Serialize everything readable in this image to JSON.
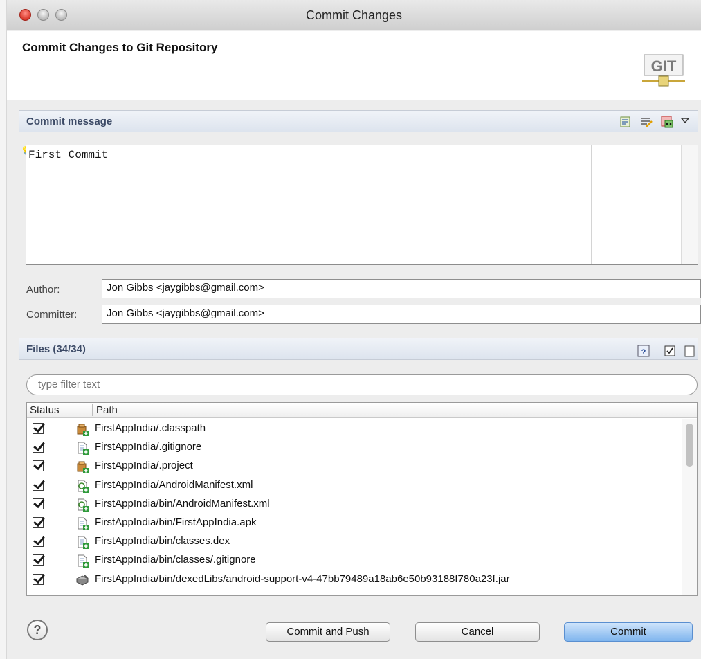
{
  "window": {
    "title": "Commit Changes"
  },
  "header": {
    "title": "Commit Changes to Git Repository",
    "logo_text": "GIT"
  },
  "commit_message": {
    "section_title": "Commit message",
    "text": "First Commit"
  },
  "author": {
    "label": "Author:",
    "value": "Jon Gibbs <jaygibbs@gmail.com>"
  },
  "committer": {
    "label": "Committer:",
    "value": "Jon Gibbs <jaygibbs@gmail.com>"
  },
  "files": {
    "section_title": "Files (34/34)",
    "filter_placeholder": "type filter text",
    "columns": {
      "status": "Status",
      "path": "Path"
    },
    "rows": [
      {
        "icon": "project-file-icon",
        "path": "FirstAppIndia/.classpath"
      },
      {
        "icon": "text-file-add-icon",
        "path": "FirstAppIndia/.gitignore"
      },
      {
        "icon": "project-file-icon",
        "path": "FirstAppIndia/.project"
      },
      {
        "icon": "xml-file-add-icon",
        "path": "FirstAppIndia/AndroidManifest.xml"
      },
      {
        "icon": "xml-file-add-icon",
        "path": "FirstAppIndia/bin/AndroidManifest.xml"
      },
      {
        "icon": "text-file-add-icon",
        "path": "FirstAppIndia/bin/FirstAppIndia.apk"
      },
      {
        "icon": "text-file-add-icon",
        "path": "FirstAppIndia/bin/classes.dex"
      },
      {
        "icon": "text-file-add-icon",
        "path": "FirstAppIndia/bin/classes/.gitignore"
      },
      {
        "icon": "jar-file-icon",
        "path": "FirstAppIndia/bin/dexedLibs/android-support-v4-47bb79489a18ab6e50b93188f780a23f.jar"
      }
    ]
  },
  "buttons": {
    "help": "?",
    "commit_and_push": "Commit and Push",
    "cancel": "Cancel",
    "commit": "Commit"
  },
  "colors": {
    "primary_button": "#7fb5ee",
    "section_title": "#3c4a66"
  }
}
